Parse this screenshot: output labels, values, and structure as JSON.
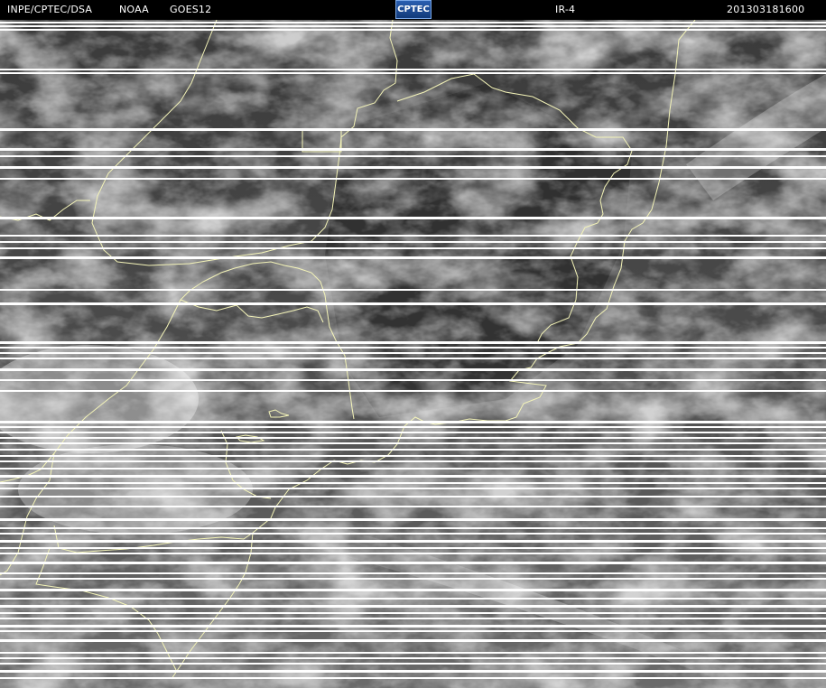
{
  "header": {
    "agency": "INPE/CPTEC/DSA",
    "source": "NOAA",
    "satellite": "GOES12",
    "logo_text": "CPTEC",
    "channel": "IR-4",
    "datetime": "201303181600"
  },
  "colors": {
    "background": "#000000",
    "header_text": "#ffffff",
    "coastline": "#f4f4b8",
    "scanline": "#ffffff",
    "logo": "#2a5fb0"
  },
  "image": {
    "type": "satellite-infrared",
    "content": "cloud cover over south-eastern South America",
    "missing_scanlines": true
  }
}
